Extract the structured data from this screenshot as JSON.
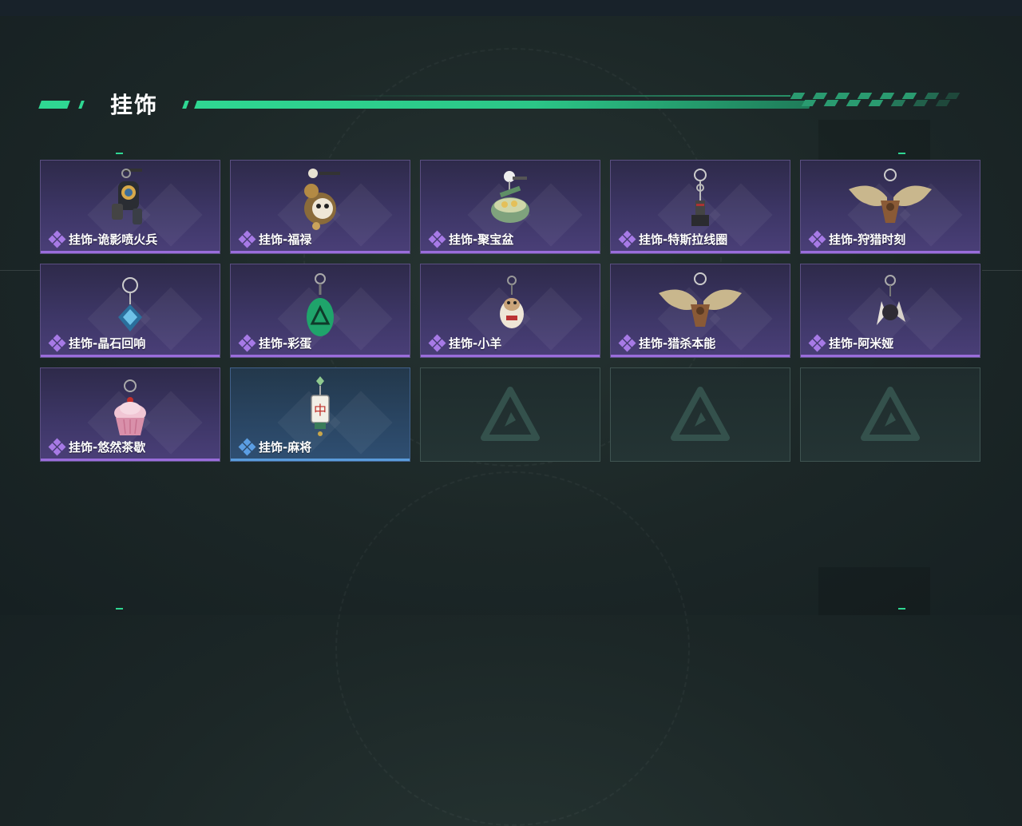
{
  "section": {
    "title": "挂饰"
  },
  "colors": {
    "accent": "#2fd792",
    "rarity_purple": "#9a6ddb",
    "rarity_blue": "#5a9cdc"
  },
  "items": [
    {
      "label": "挂饰-诡影喷火兵",
      "rarity": "purple",
      "icon": "flamethrower-soldier-charm-icon"
    },
    {
      "label": "挂饰-福禄",
      "rarity": "purple",
      "icon": "panda-gourd-charm-icon"
    },
    {
      "label": "挂饰-聚宝盆",
      "rarity": "purple",
      "icon": "treasure-bowl-charm-icon"
    },
    {
      "label": "挂饰-特斯拉线圈",
      "rarity": "purple",
      "icon": "tesla-coil-charm-icon"
    },
    {
      "label": "挂饰-狩猎时刻",
      "rarity": "purple",
      "icon": "moose-antler-charm-icon"
    },
    {
      "label": "挂饰-晶石回响",
      "rarity": "purple",
      "icon": "crystal-charm-icon"
    },
    {
      "label": "挂饰-彩蛋",
      "rarity": "purple",
      "icon": "green-egg-charm-icon"
    },
    {
      "label": "挂饰-小羊",
      "rarity": "purple",
      "icon": "lamb-charm-icon"
    },
    {
      "label": "挂饰-猎杀本能",
      "rarity": "purple",
      "icon": "moose-antler-charm-icon"
    },
    {
      "label": "挂饰-阿米娅",
      "rarity": "purple",
      "icon": "amiya-charm-icon"
    },
    {
      "label": "挂饰-悠然茶歇",
      "rarity": "purple",
      "icon": "cupcake-charm-icon"
    },
    {
      "label": "挂饰-麻将",
      "rarity": "blue",
      "icon": "mahjong-tile-charm-icon"
    },
    {
      "label": "",
      "rarity": "empty",
      "icon": "empty-slot-logo-icon"
    },
    {
      "label": "",
      "rarity": "empty",
      "icon": "empty-slot-logo-icon"
    },
    {
      "label": "",
      "rarity": "empty",
      "icon": "empty-slot-logo-icon"
    }
  ]
}
